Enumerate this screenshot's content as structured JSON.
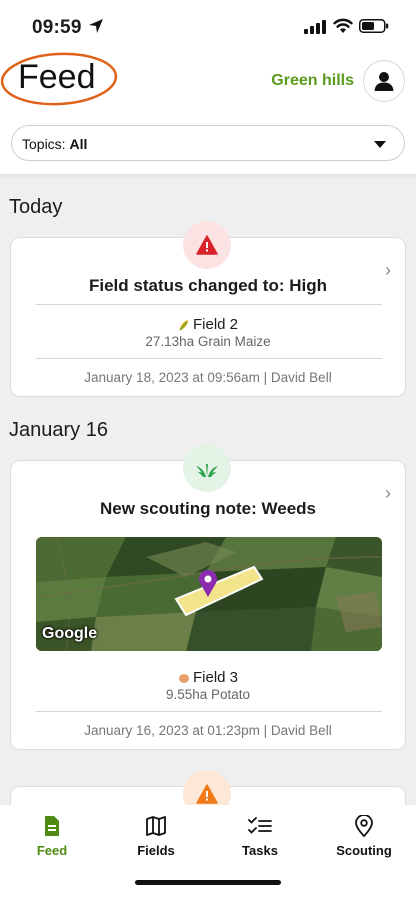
{
  "status_bar": {
    "time": "09:59"
  },
  "header": {
    "title": "Feed",
    "farm_name": "Green hills",
    "topics_label": "Topics:",
    "topics_value": "All"
  },
  "sections": [
    {
      "heading": "Today"
    },
    {
      "heading": "January 16"
    }
  ],
  "cards": [
    {
      "status_icon": "warning-icon",
      "badge_color": "#d9232b",
      "title": "Field status changed to: High",
      "field_name": "Field 2",
      "field_meta": "27.13ha  Grain Maize",
      "footer": "January 18, 2023 at 09:56am  |  David Bell"
    },
    {
      "status_icon": "weeds-icon",
      "badge_color": "#2aa14b",
      "title": "New scouting note: Weeds",
      "map_attribution": "Google",
      "field_name": "Field 3",
      "field_meta": "9.55ha  Potato",
      "footer": "January 16, 2023 at 01:23pm  |  David Bell"
    },
    {
      "status_icon": "warning-icon",
      "badge_color": "#f07a1a"
    }
  ],
  "tabs": [
    {
      "label": "Feed",
      "icon": "feed-icon",
      "active": true
    },
    {
      "label": "Fields",
      "icon": "map-icon",
      "active": false
    },
    {
      "label": "Tasks",
      "icon": "tasks-icon",
      "active": false
    },
    {
      "label": "Scouting",
      "icon": "location-pin-icon",
      "active": false
    }
  ],
  "colors": {
    "accent": "#5a9a1d",
    "active_tab": "#4f8a14",
    "annotation": "#e0621a"
  }
}
